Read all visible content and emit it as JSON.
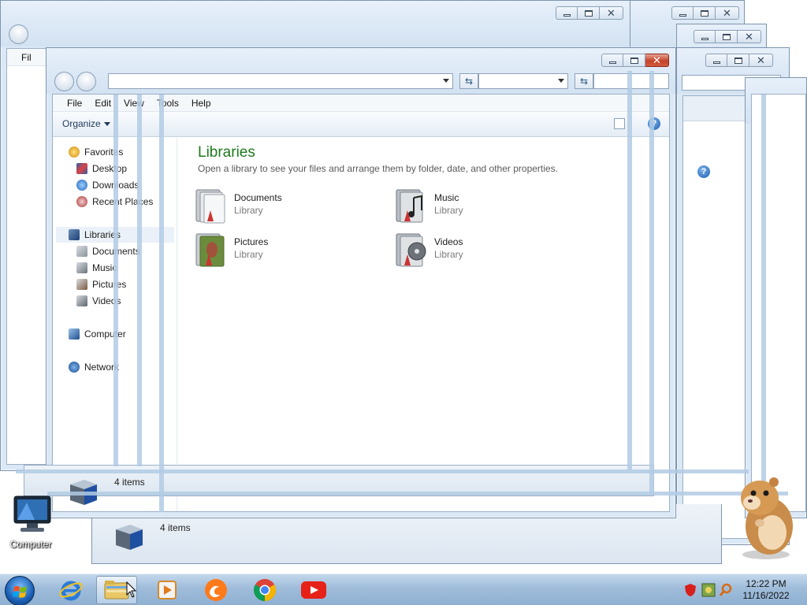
{
  "front_window": {
    "menu": [
      "File",
      "Edit",
      "View",
      "Tools",
      "Help"
    ],
    "organize_label": "Organize",
    "nav": {
      "favorites": "Favorites",
      "desktop": "Desktop",
      "downloads": "Downloads",
      "recent_places": "Recent Places",
      "libraries": "Libraries",
      "documents": "Documents",
      "music": "Music",
      "pictures": "Pictures",
      "videos": "Videos",
      "computer": "Computer",
      "network": "Network"
    },
    "heading": "Libraries",
    "subheading": "Open a library to see your files and arrange them by folder, date, and other properties.",
    "libraries": [
      {
        "name": "Documents",
        "type": "Library"
      },
      {
        "name": "Music",
        "type": "Library"
      },
      {
        "name": "Pictures",
        "type": "Library"
      },
      {
        "name": "Videos",
        "type": "Library"
      }
    ],
    "status": "4 items"
  },
  "back_window": {
    "menu_fragment": "Fil",
    "status": "4 items"
  },
  "desktop": {
    "computer_icon_label": "Computer"
  },
  "taskbar": {
    "time": "12:22 PM",
    "date": "11/16/2022"
  },
  "icons": {
    "help": "?",
    "refresh": "⇆",
    "search": "⌕",
    "close": "✕"
  },
  "colors": {
    "libraries_heading": "#1e7a1e",
    "close_button": "#c4432a",
    "taskbar": "#9fbcda"
  }
}
